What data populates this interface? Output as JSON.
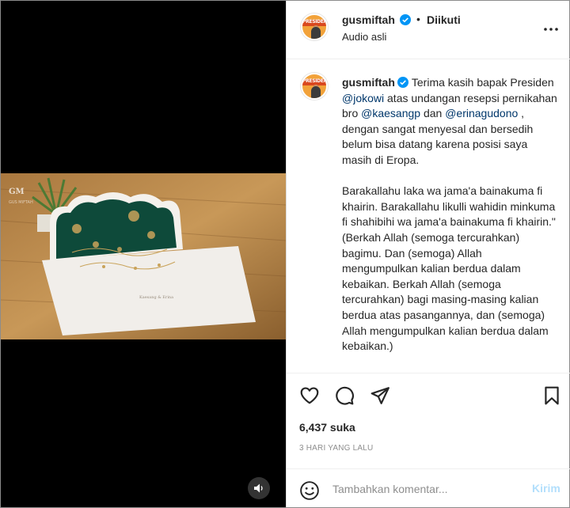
{
  "post": {
    "username": "gusmiftah",
    "follow_status": "Diikuti",
    "separator": "•",
    "audio": "Audio asli"
  },
  "video": {
    "watermark": "GM",
    "watermark_sub": "GUS MIFTAH",
    "card_text": "Kaesang & Erina",
    "mute_icon": "speaker-icon"
  },
  "avatar_label": "PRESIDEN",
  "caption": {
    "username": "gusmiftah",
    "p1": "Terima kasih bapak Presiden ",
    "m1": "@jokowi",
    "p2": " atas undangan resepsi pernikahan bro ",
    "m2": "@kaesangp",
    "p3": " dan ",
    "m3": "@erinagudono",
    "p4": " , dengan sangat menyesal dan bersedih belum bisa datang karena posisi saya masih di Eropa.\n\nBarakallahu laka wa jama'a bainakuma fi khairin. Barakallahu likulli wahidin minkuma fi shahibihi wa jama'a bainakuma fi khairin.\" (Berkah Allah (semoga tercurahkan) bagimu. Dan (semoga) Allah mengumpulkan kalian berdua dalam kebaikan. Berkah Allah (semoga tercurahkan) bagi masing-masing kalian berdua atas pasangannya, dan (semoga) Allah mengumpulkan kalian berdua dalam kebaikan.)"
  },
  "stats": {
    "likes": "6,437 suka",
    "time_ago": "3 HARI YANG LALU"
  },
  "comment": {
    "placeholder": "Tambahkan komentar...",
    "post_label": "Kirim"
  },
  "colors": {
    "verified_blue": "#0095f6",
    "mention": "#00376b",
    "post_disabled": "#b2dffc",
    "card_green": "#0e4a3a"
  }
}
